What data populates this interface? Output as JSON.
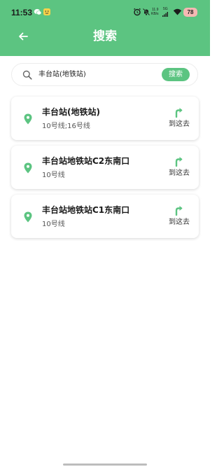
{
  "status_bar": {
    "time": "11:53",
    "net_speed_value": "11.9",
    "net_speed_unit": "KB/s",
    "network": "5G",
    "battery": "78"
  },
  "header": {
    "title": "搜索",
    "back_icon": "arrow-left-icon"
  },
  "search": {
    "value": "丰台站(地铁站)",
    "button_label": "搜索",
    "icon": "search-icon"
  },
  "results": [
    {
      "name": "丰台站(地铁站)",
      "lines": "10号线;16号线",
      "action": "到这去"
    },
    {
      "name": "丰台站地铁站C2东南口",
      "lines": "10号线",
      "action": "到这去"
    },
    {
      "name": "丰台站地铁站C1东南口",
      "lines": "10号线",
      "action": "到这去"
    }
  ],
  "colors": {
    "accent": "#5cc481",
    "battery_bg": "#f6b8b3"
  }
}
